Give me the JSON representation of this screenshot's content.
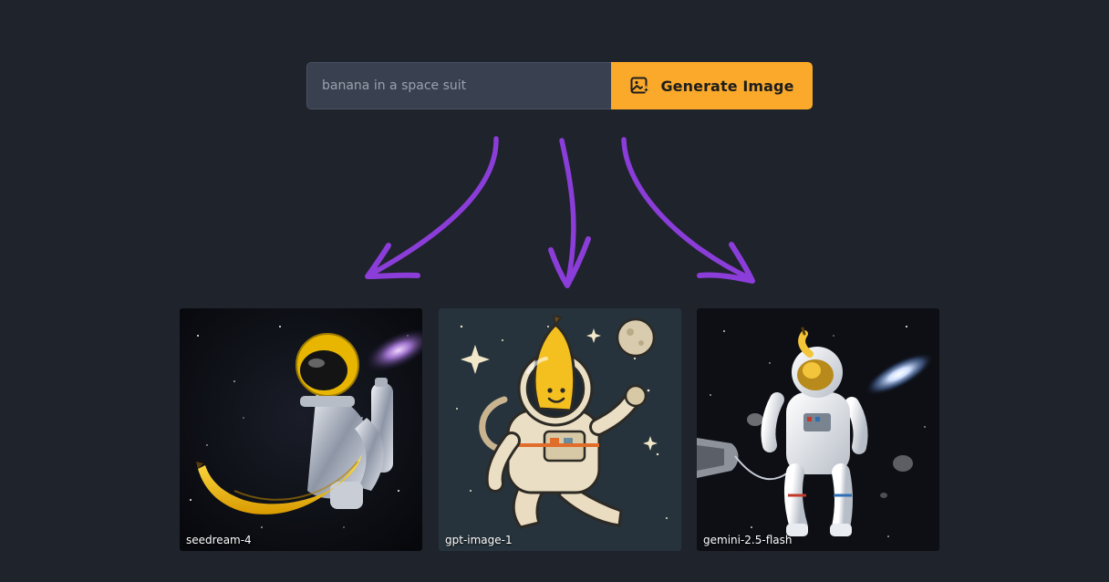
{
  "prompt": {
    "placeholder": "banana in a space suit",
    "value": ""
  },
  "generate_button": {
    "label": "Generate Image",
    "icon": "image-sparkle-icon"
  },
  "colors": {
    "background": "#1f232b",
    "input_background": "#394150",
    "button_accent": "#fba92a",
    "arrow": "#8b3dd9"
  },
  "results": [
    {
      "model": "seedream-4",
      "image": "banana-astronaut-realistic"
    },
    {
      "model": "gpt-image-1",
      "image": "banana-astronaut-cartoon"
    },
    {
      "model": "gemini-2.5-flash",
      "image": "banana-astronaut-photoreal"
    }
  ]
}
